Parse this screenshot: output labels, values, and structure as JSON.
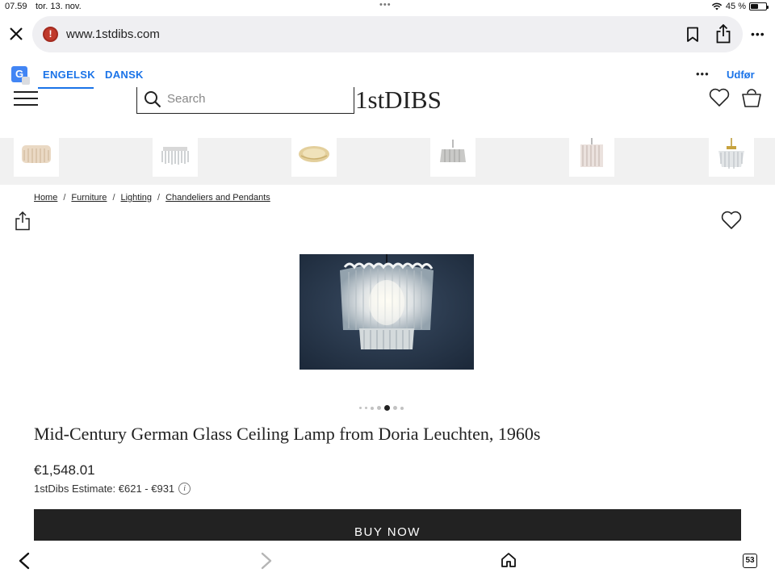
{
  "status_bar": {
    "time": "07.59",
    "date": "tor. 13. nov.",
    "battery": "45 %",
    "battery_level": 0.45
  },
  "browser": {
    "url": "www.1stdibs.com",
    "tab_count": "53"
  },
  "translate_bar": {
    "lang_from": "ENGELSK",
    "lang_to": "DANSK",
    "action": "Udfør",
    "accent": "#1a73e8"
  },
  "header": {
    "search_placeholder": "Search",
    "logo": "1stDIBS"
  },
  "thumbnails": [
    {
      "name": "thumb-tube-chandelier"
    },
    {
      "name": "thumb-crystal-chandelier"
    },
    {
      "name": "thumb-flush-mount"
    },
    {
      "name": "thumb-glass-pendant"
    },
    {
      "name": "thumb-ice-glass-pendant"
    },
    {
      "name": "thumb-cascade-chandelier"
    }
  ],
  "breadcrumb": [
    "Home",
    "Furniture",
    "Lighting",
    "Chandeliers and Pendants"
  ],
  "product": {
    "title": "Mid-Century German Glass Ceiling Lamp from Doria Leuchten, 1960s",
    "price": "€1,548.01",
    "estimate": "1stDibs Estimate: €621 - €931",
    "buy_label": "BUY NOW",
    "image_count": 7,
    "active_image": 5
  }
}
